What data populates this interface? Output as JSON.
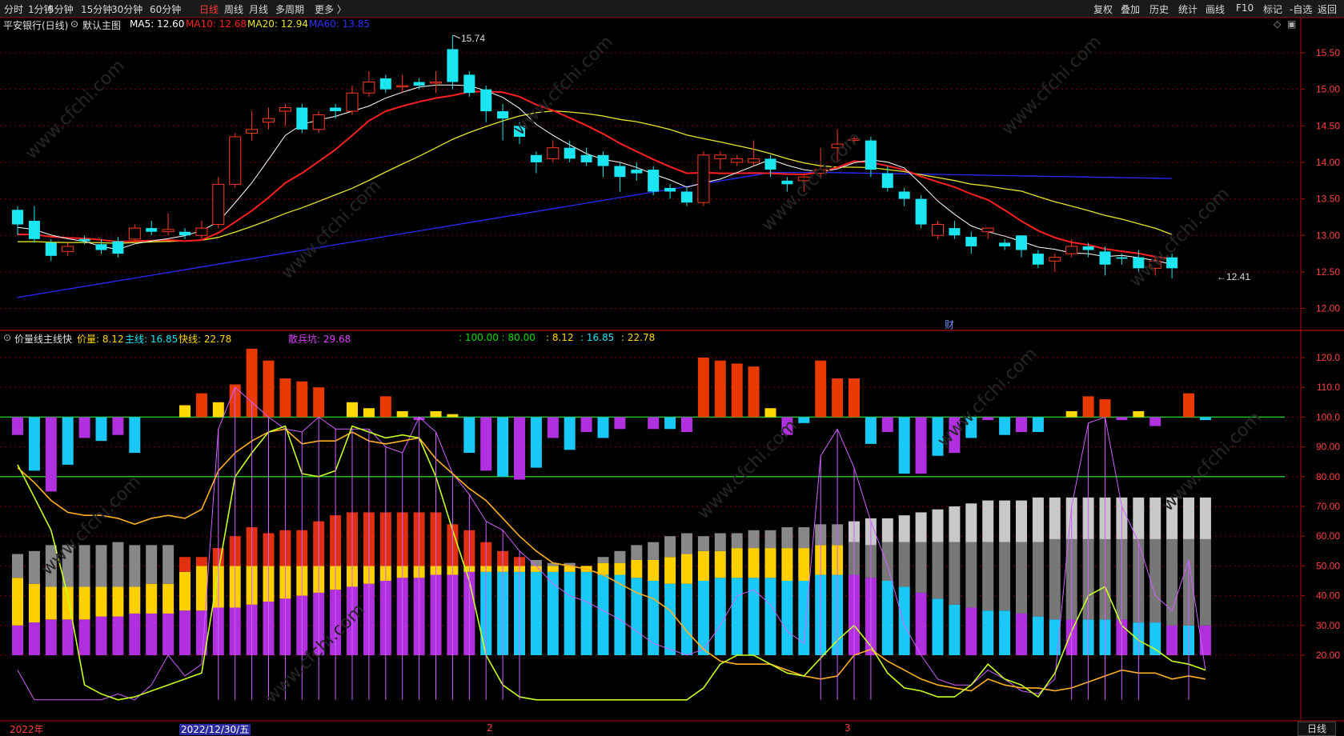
{
  "toolbar": {
    "left": [
      "分时",
      "1分钟",
      "5分钟",
      "15分钟",
      "30分钟",
      "60分钟",
      "日线",
      "周线",
      "月线",
      "多周期",
      "更多 〉"
    ],
    "active": "日线",
    "right": [
      "复权",
      "叠加",
      "历史",
      "统计",
      "画线",
      "F10",
      "标记",
      "-自选",
      "返回"
    ]
  },
  "main_info": {
    "title": "平安银行(日线)",
    "template": "默认主图",
    "ma5": "MA5: 12.60",
    "ma10": "MA10: 12.68",
    "ma20": "MA20: 12.94",
    "ma60": "MA60: 13.85"
  },
  "indicator_info": {
    "name": "价量线主线快",
    "jl": "价量: 8.12",
    "zx": "主线: 16.85",
    "kx": "快线: 22.78",
    "sbk": "散兵坑: 29.68",
    "vals_green": ": 100.00 : 80.00",
    "vals_yellow": ": 8.12",
    "vals_cyan": ": 16.85",
    "vals_yellow2": ": 22.78"
  },
  "annotations": {
    "high": "15.74",
    "low": "←12.41",
    "cai": "财"
  },
  "bottom": {
    "year": "2022年",
    "date": "2022/12/30/五",
    "m2": "2",
    "m3": "3",
    "period": "日线"
  },
  "colors": {
    "up": "#ff3a1a",
    "down": "#19e6f0",
    "ma5": "#ffffff",
    "ma10": "#ff2020",
    "ma20": "#e6e62a",
    "ma60": "#2a2aff",
    "grid": "#7a0000"
  },
  "chart_data": {
    "type": "candlestick",
    "price_ticks": [
      "15.50",
      "15.00",
      "14.50",
      "14.00",
      "13.50",
      "13.00",
      "12.50",
      "12.00"
    ],
    "ind_ticks": [
      "120.0",
      "110.0",
      "100.0",
      "90.00",
      "80.00",
      "70.00",
      "60.00",
      "50.00",
      "40.00",
      "30.00",
      "20.00"
    ],
    "candles": [
      [
        13.35,
        13.15,
        13.4,
        13.0
      ],
      [
        13.2,
        12.95,
        13.4,
        12.9
      ],
      [
        12.9,
        12.72,
        12.95,
        12.65
      ],
      [
        12.78,
        12.85,
        12.9,
        12.72
      ],
      [
        12.95,
        12.92,
        13.0,
        12.88
      ],
      [
        12.88,
        12.8,
        12.95,
        12.75
      ],
      [
        12.92,
        12.75,
        12.98,
        12.7
      ],
      [
        12.95,
        13.1,
        13.15,
        12.9
      ],
      [
        13.1,
        13.05,
        13.2,
        13.0
      ],
      [
        13.05,
        13.08,
        13.3,
        13.0
      ],
      [
        13.05,
        13.0,
        13.1,
        12.95
      ],
      [
        13.0,
        13.1,
        13.2,
        12.95
      ],
      [
        13.15,
        13.7,
        13.8,
        13.1
      ],
      [
        13.7,
        14.35,
        14.4,
        13.65
      ],
      [
        14.4,
        14.45,
        14.7,
        14.3
      ],
      [
        14.55,
        14.6,
        14.75,
        14.45
      ],
      [
        14.7,
        14.75,
        14.8,
        14.5
      ],
      [
        14.75,
        14.45,
        14.8,
        14.4
      ],
      [
        14.45,
        14.65,
        14.7,
        14.4
      ],
      [
        14.75,
        14.7,
        14.8,
        14.6
      ],
      [
        14.7,
        14.95,
        15.05,
        14.65
      ],
      [
        14.95,
        15.1,
        15.25,
        14.9
      ],
      [
        15.15,
        15.0,
        15.2,
        14.95
      ],
      [
        15.05,
        15.05,
        15.2,
        14.95
      ],
      [
        15.1,
        15.05,
        15.15,
        15.0
      ],
      [
        15.1,
        15.1,
        15.25,
        14.95
      ],
      [
        15.55,
        15.1,
        15.74,
        15.0
      ],
      [
        15.2,
        14.95,
        15.25,
        14.9
      ],
      [
        15.0,
        14.7,
        15.05,
        14.55
      ],
      [
        14.7,
        14.6,
        14.8,
        14.3
      ],
      [
        14.5,
        14.35,
        14.55,
        14.25
      ],
      [
        14.1,
        14.0,
        14.15,
        13.85
      ],
      [
        14.05,
        14.2,
        14.3,
        14.0
      ],
      [
        14.2,
        14.05,
        14.3,
        14.0
      ],
      [
        14.1,
        14.0,
        14.2,
        13.95
      ],
      [
        14.1,
        13.95,
        14.15,
        13.8
      ],
      [
        13.95,
        13.8,
        14.0,
        13.6
      ],
      [
        13.9,
        13.85,
        14.0,
        13.75
      ],
      [
        13.9,
        13.6,
        13.95,
        13.55
      ],
      [
        13.65,
        13.6,
        13.7,
        13.5
      ],
      [
        13.6,
        13.45,
        13.65,
        13.4
      ],
      [
        13.45,
        14.1,
        14.15,
        13.4
      ],
      [
        14.05,
        14.1,
        14.15,
        13.9
      ],
      [
        14.0,
        14.05,
        14.1,
        13.95
      ],
      [
        14.0,
        14.05,
        14.3,
        13.95
      ],
      [
        14.05,
        13.9,
        14.1,
        13.8
      ],
      [
        13.75,
        13.7,
        13.8,
        13.6
      ],
      [
        13.75,
        13.8,
        13.85,
        13.6
      ],
      [
        13.85,
        13.9,
        14.2,
        13.8
      ],
      [
        14.2,
        14.25,
        14.45,
        14.0
      ],
      [
        14.3,
        14.32,
        14.35,
        14.25
      ],
      [
        14.3,
        13.9,
        14.35,
        13.8
      ],
      [
        13.85,
        13.65,
        13.95,
        13.6
      ],
      [
        13.6,
        13.5,
        13.65,
        13.4
      ],
      [
        13.5,
        13.15,
        13.55,
        13.1
      ],
      [
        13.0,
        13.15,
        13.2,
        12.95
      ],
      [
        13.1,
        13.0,
        13.2,
        12.95
      ],
      [
        12.98,
        12.85,
        13.05,
        12.75
      ],
      [
        13.05,
        13.1,
        13.1,
        12.95
      ],
      [
        12.9,
        12.85,
        12.95,
        12.8
      ],
      [
        13.0,
        12.8,
        13.0,
        12.7
      ],
      [
        12.75,
        12.6,
        12.8,
        12.55
      ],
      [
        12.65,
        12.7,
        12.75,
        12.5
      ],
      [
        12.75,
        12.85,
        12.95,
        12.7
      ],
      [
        12.85,
        12.8,
        12.9,
        12.7
      ],
      [
        12.78,
        12.6,
        12.85,
        12.45
      ],
      [
        12.7,
        12.68,
        12.75,
        12.6
      ],
      [
        12.7,
        12.55,
        12.8,
        12.5
      ],
      [
        12.55,
        12.65,
        12.7,
        12.45
      ],
      [
        12.7,
        12.55,
        12.75,
        12.41
      ]
    ],
    "ind_bars": [
      [
        94,
        0
      ],
      [
        82,
        0
      ],
      [
        75,
        0
      ],
      [
        84,
        0
      ],
      [
        93,
        0
      ],
      [
        92,
        0
      ],
      [
        94,
        0
      ],
      [
        88,
        0
      ],
      [
        0,
        0
      ],
      [
        0,
        0
      ],
      [
        104,
        1
      ],
      [
        108,
        1
      ],
      [
        105,
        1
      ],
      [
        111,
        1
      ],
      [
        123,
        1
      ],
      [
        119,
        1
      ],
      [
        113,
        1
      ],
      [
        112,
        1
      ],
      [
        110,
        1
      ],
      [
        0,
        0
      ],
      [
        105,
        1
      ],
      [
        103,
        1
      ],
      [
        107,
        1
      ],
      [
        102,
        1
      ],
      [
        99,
        0
      ],
      [
        102,
        1
      ],
      [
        101,
        1
      ],
      [
        88,
        0
      ],
      [
        82,
        0
      ],
      [
        80,
        0
      ],
      [
        79,
        0
      ],
      [
        83,
        0
      ],
      [
        93,
        0
      ],
      [
        89,
        0
      ],
      [
        95,
        0
      ],
      [
        93,
        0
      ],
      [
        96,
        0
      ],
      [
        100,
        0
      ],
      [
        96,
        0
      ],
      [
        96,
        0
      ],
      [
        95,
        0
      ],
      [
        120,
        1
      ],
      [
        119,
        1
      ],
      [
        118,
        1
      ],
      [
        117,
        1
      ],
      [
        103,
        1
      ],
      [
        94,
        0
      ],
      [
        98,
        0
      ],
      [
        119,
        1
      ],
      [
        113,
        1
      ],
      [
        113,
        1
      ],
      [
        91,
        0
      ],
      [
        95,
        0
      ],
      [
        81,
        0
      ],
      [
        81,
        0
      ],
      [
        87,
        0
      ],
      [
        88,
        0
      ],
      [
        93,
        0
      ],
      [
        99,
        0
      ],
      [
        94,
        0
      ],
      [
        95,
        0
      ],
      [
        95,
        0
      ],
      [
        0,
        0
      ],
      [
        102,
        1
      ],
      [
        107,
        1
      ],
      [
        106,
        1
      ],
      [
        99,
        0
      ],
      [
        102,
        1
      ],
      [
        97,
        0
      ],
      [
        0,
        0
      ],
      [
        108,
        1
      ],
      [
        99,
        0
      ]
    ],
    "stack_bars": [
      [
        30,
        46,
        54
      ],
      [
        31,
        44,
        55
      ],
      [
        32,
        43,
        57
      ],
      [
        32,
        43,
        57
      ],
      [
        32,
        43,
        57
      ],
      [
        33,
        43,
        57
      ],
      [
        33,
        43,
        58
      ],
      [
        34,
        43,
        57
      ],
      [
        34,
        44,
        57
      ],
      [
        34,
        44,
        57
      ],
      [
        35,
        48,
        53
      ],
      [
        35,
        50,
        53
      ],
      [
        36,
        50,
        56
      ],
      [
        36,
        50,
        60
      ],
      [
        37,
        50,
        63
      ],
      [
        38,
        50,
        61
      ],
      [
        39,
        50,
        62
      ],
      [
        40,
        50,
        62
      ],
      [
        41,
        50,
        65
      ],
      [
        42,
        50,
        67
      ],
      [
        43,
        50,
        68
      ],
      [
        44,
        50,
        68
      ],
      [
        45,
        50,
        68
      ],
      [
        46,
        50,
        68
      ],
      [
        46,
        50,
        68
      ],
      [
        47,
        50,
        68
      ],
      [
        47,
        50,
        64
      ],
      [
        48,
        50,
        62
      ],
      [
        48,
        50,
        58
      ],
      [
        48,
        50,
        55
      ],
      [
        48,
        50,
        53
      ],
      [
        48,
        50,
        52
      ],
      [
        48,
        50,
        51
      ],
      [
        48,
        50,
        51
      ],
      [
        48,
        50,
        50
      ],
      [
        47,
        51,
        53
      ],
      [
        47,
        51,
        55
      ],
      [
        46,
        52,
        57
      ],
      [
        45,
        52,
        58
      ],
      [
        44,
        53,
        60
      ],
      [
        44,
        54,
        61
      ],
      [
        45,
        55,
        60
      ],
      [
        46,
        55,
        61
      ],
      [
        46,
        56,
        61
      ],
      [
        46,
        56,
        62
      ],
      [
        46,
        56,
        62
      ],
      [
        45,
        56,
        63
      ],
      [
        45,
        56,
        63
      ],
      [
        47,
        57,
        64
      ],
      [
        47,
        57,
        64
      ],
      [
        47,
        58,
        65
      ],
      [
        46,
        57,
        66
      ],
      [
        45,
        58,
        66
      ],
      [
        43,
        58,
        67
      ],
      [
        41,
        58,
        68
      ],
      [
        39,
        58,
        69
      ],
      [
        37,
        58,
        70
      ],
      [
        36,
        58,
        71
      ],
      [
        35,
        58,
        72
      ],
      [
        35,
        58,
        72
      ],
      [
        34,
        58,
        72
      ],
      [
        33,
        58,
        73
      ],
      [
        32,
        59,
        73
      ],
      [
        32,
        59,
        73
      ],
      [
        32,
        59,
        73
      ],
      [
        32,
        59,
        73
      ],
      [
        32,
        59,
        73
      ],
      [
        31,
        59,
        73
      ],
      [
        31,
        59,
        73
      ],
      [
        30,
        59,
        73
      ],
      [
        30,
        59,
        73
      ],
      [
        30,
        59,
        73
      ]
    ]
  }
}
